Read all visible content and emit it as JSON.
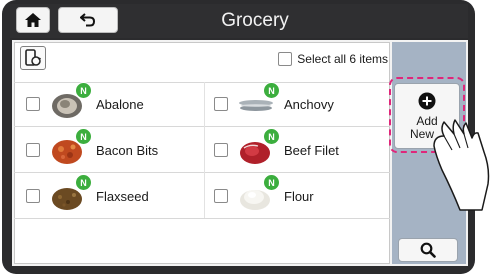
{
  "header": {
    "title": "Grocery",
    "home_icon": "home-icon",
    "back_icon": "back-arrow-icon"
  },
  "toolbar": {
    "sync_icon": "phone-sync-icon",
    "select_all_label": "Select all 6 items",
    "select_all_checked": false
  },
  "items": [
    {
      "label": "Abalone",
      "badge": "N",
      "checked": false,
      "icon": "abalone-icon"
    },
    {
      "label": "Anchovy",
      "badge": "N",
      "checked": false,
      "icon": "anchovy-icon"
    },
    {
      "label": "Bacon Bits",
      "badge": "N",
      "checked": false,
      "icon": "bacon-bits-icon"
    },
    {
      "label": "Beef Filet",
      "badge": "N",
      "checked": false,
      "icon": "beef-filet-icon"
    },
    {
      "label": "Flaxseed",
      "badge": "N",
      "checked": false,
      "icon": "flaxseed-icon"
    },
    {
      "label": "Flour",
      "badge": "N",
      "checked": false,
      "icon": "flour-icon"
    }
  ],
  "sidebar": {
    "add_label_line1": "Add",
    "add_label_line2": "New",
    "add_icon": "plus-circle-icon",
    "search_icon": "search-icon"
  },
  "colors": {
    "badge": "#3cae3e",
    "highlight": "#e0267a",
    "sidebar": "#a5b3c4",
    "topbar": "#2f2f31"
  }
}
